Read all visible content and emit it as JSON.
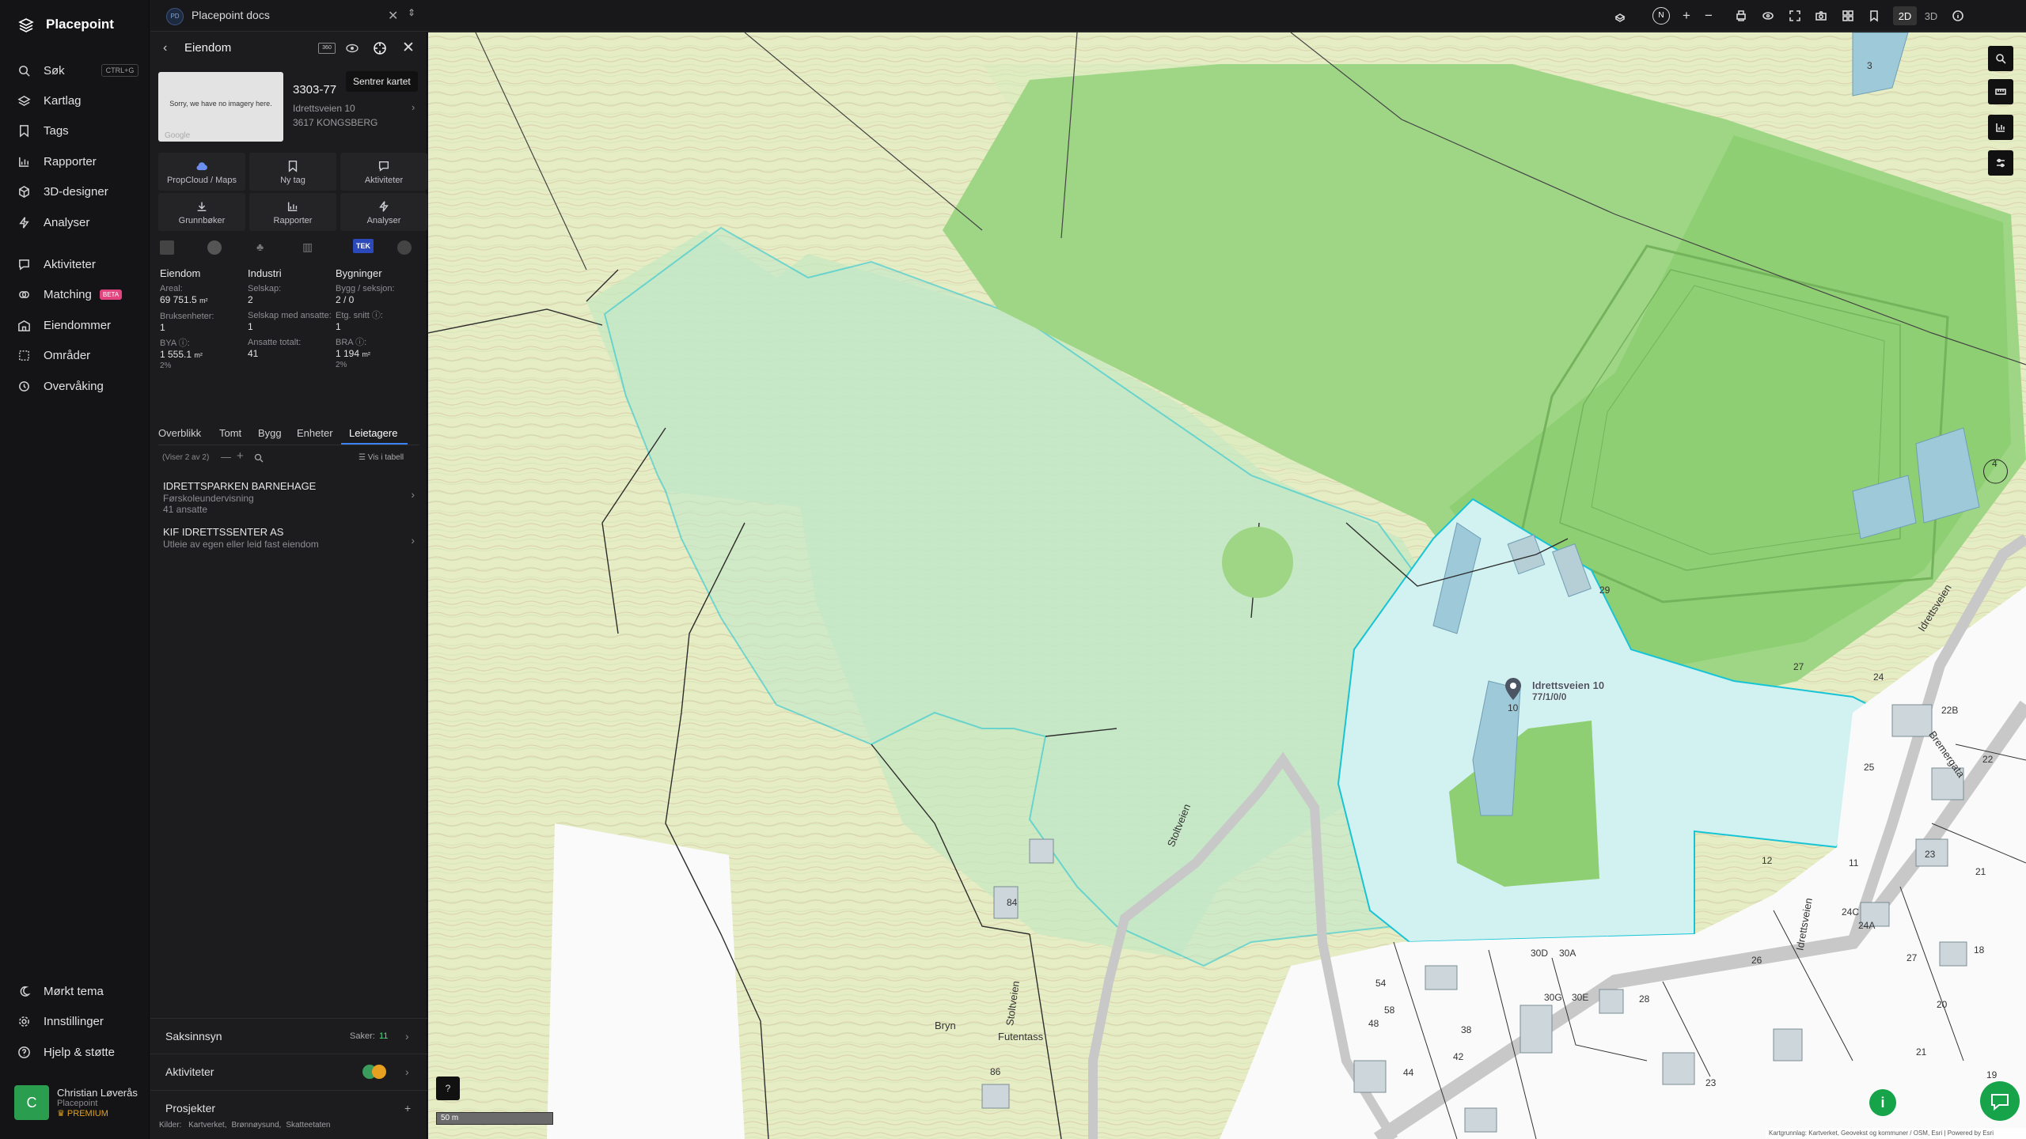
{
  "app": {
    "name": "Placepoint"
  },
  "nav": {
    "search": {
      "label": "Søk",
      "shortcut": "CTRL+G"
    },
    "items": [
      {
        "label": "Kartlag",
        "icon": "layers-icon"
      },
      {
        "label": "Tags",
        "icon": "bookmark-icon"
      },
      {
        "label": "Rapporter",
        "icon": "chart-icon"
      },
      {
        "label": "3D-designer",
        "icon": "cube-icon"
      },
      {
        "label": "Analyser",
        "icon": "bolt-icon"
      }
    ],
    "items2": [
      {
        "label": "Aktiviteter",
        "icon": "chat-icon"
      },
      {
        "label": "Matching",
        "icon": "matching-icon",
        "badge": "BETA"
      },
      {
        "label": "Eiendommer",
        "icon": "property-icon"
      },
      {
        "label": "Områder",
        "icon": "area-icon"
      },
      {
        "label": "Overvåking",
        "icon": "monitor-icon"
      }
    ],
    "bottom": [
      {
        "label": "Mørkt tema",
        "icon": "moon-icon"
      },
      {
        "label": "Innstillinger",
        "icon": "gear-icon"
      },
      {
        "label": "Hjelp & støtte",
        "icon": "help-icon"
      }
    ],
    "user": {
      "initial": "C",
      "name": "Christian Løverås",
      "org": "Placepoint",
      "plan": "PREMIUM"
    }
  },
  "doc_tab": {
    "badge": "PD",
    "title": "Placepoint docs"
  },
  "panel": {
    "title": "Eiendom",
    "tooltip": "Sentrer kartet",
    "thumbnail": {
      "text": "Sorry, we have no imagery here.",
      "brand": "Google"
    },
    "property_id": "3303-77",
    "address": "Idrettsveien 10",
    "postal": "3617 KONGSBERG",
    "actions": [
      {
        "label": "PropCloud / Maps",
        "icon": "cloud-icon"
      },
      {
        "label": "Ny tag",
        "icon": "tag-icon"
      },
      {
        "label": "Aktiviteter",
        "icon": "chat-icon"
      },
      {
        "label": "Grunnbøker",
        "icon": "download-icon"
      },
      {
        "label": "Rapporter",
        "icon": "chart-icon"
      },
      {
        "label": "Analyser",
        "icon": "bolt-icon"
      }
    ],
    "tek_label": "TEK",
    "stats": {
      "col1": {
        "heading": "Eiendom",
        "area_label": "Areal:",
        "area_value": "69 751.5",
        "area_unit": "m²",
        "units_label": "Bruksenheter:",
        "units_value": "1",
        "bya_label": "BYA ⓘ:",
        "bya_value": "1 555.1",
        "bya_unit": "m²",
        "bya_pct": "2%"
      },
      "col2": {
        "heading": "Industri",
        "companies_label": "Selskap:",
        "companies_value": "2",
        "employed_label": "Selskap med ansatte:",
        "employed_value": "1",
        "total_label": "Ansatte totalt:",
        "total_value": "41"
      },
      "col3": {
        "heading": "Bygninger",
        "bldg_label": "Bygg / seksjon:",
        "bldg_value": "2 / 0",
        "floors_label": "Etg. snitt ⓘ:",
        "floors_value": "1",
        "bra_label": "BRA ⓘ:",
        "bra_value": "1 194",
        "bra_unit": "m²",
        "bra_pct": "2%"
      }
    },
    "subtabs": [
      "Overblikk",
      "Tomt",
      "Bygg",
      "Enheter",
      "Leietagere"
    ],
    "active_subtab": "Leietagere",
    "list_meta": "(Viser 2 av 2)",
    "table_view": "Vis i tabell",
    "tenants": [
      {
        "name": "IDRETTSPARKEN BARNEHAGE",
        "industry": "Førskoleundervisning",
        "employees": "41 ansatte"
      },
      {
        "name": "KIF IDRETTSSENTER AS",
        "industry": "Utleie av egen eller leid fast eiendom",
        "employees": ""
      }
    ],
    "sections": {
      "cases": {
        "label": "Saksinnsyn",
        "count_label": "Saker:",
        "count": "11"
      },
      "activities": {
        "label": "Aktiviteter"
      },
      "projects": {
        "label": "Prosjekter"
      }
    },
    "sources": {
      "label": "Kilder:",
      "items": [
        "Kartverket,",
        "Brønnøysund,",
        "Skatteetaten"
      ]
    }
  },
  "toolbar": {
    "compass": "N",
    "view_2d": "2D",
    "view_3d": "3D"
  },
  "map": {
    "scale": "50 m",
    "attribution": "Kartgrunnlag: Kartverket, Geovekst og kommuner / OSM, Esri | Powered by Esri",
    "marker": {
      "line1": "Idrettsveien 10",
      "line2": "77/1/0/0"
    },
    "roads": [
      "Stoltveien",
      "Stoltveien",
      "Idrettsveien",
      "Bremergata",
      "Idrettsveien"
    ],
    "place_names": [
      "Bryn",
      "Futentass"
    ],
    "numbers": [
      "3",
      "4",
      "29",
      "27",
      "24",
      "22B",
      "22",
      "25",
      "11",
      "23",
      "21",
      "12",
      "24C",
      "24A",
      "27",
      "18",
      "20",
      "21",
      "19",
      "23",
      "28",
      "30D",
      "30A",
      "30G",
      "30E",
      "26",
      "54",
      "58",
      "38",
      "48",
      "42",
      "44",
      "84",
      "86",
      "10"
    ]
  }
}
